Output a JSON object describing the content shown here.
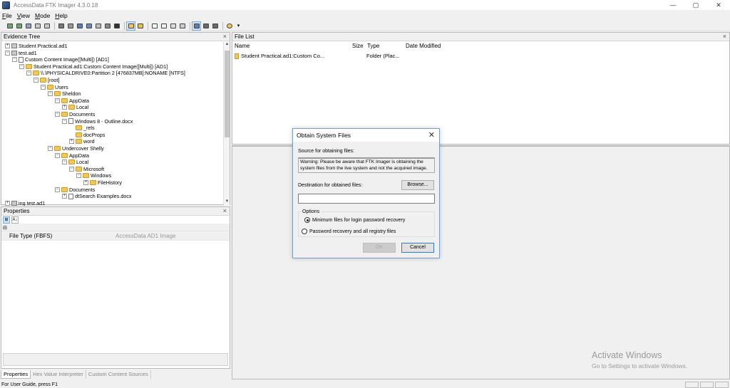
{
  "window": {
    "title": "AccessData FTK Imager 4.3.0.18",
    "minimize": "—",
    "maximize": "▢",
    "close": "✕"
  },
  "menu": [
    {
      "label": "File",
      "underline": "F",
      "rest": "ile"
    },
    {
      "label": "View",
      "underline": "V",
      "rest": "iew"
    },
    {
      "label": "Mode",
      "underline": "M",
      "rest": "ode"
    },
    {
      "label": "Help",
      "underline": "H",
      "rest": "elp"
    }
  ],
  "evidence_tree": {
    "title": "Evidence Tree",
    "close": "×",
    "items": [
      {
        "label": "Student Practical.ad1",
        "level": 0,
        "toggle": "+",
        "icon": "drive-icon"
      },
      {
        "label": "test.ad1",
        "level": 0,
        "toggle": "−",
        "icon": "drive-icon"
      },
      {
        "label": "Custom Content Image([Multi]) [AD1]",
        "level": 1,
        "toggle": "−",
        "icon": "image-icon"
      },
      {
        "label": "Student Practical.ad1:Custom Content Image([Multi]) [AD1]",
        "level": 2,
        "toggle": "−",
        "icon": "folder-icon"
      },
      {
        "label": "\\\\.\\PHYSICALDRIVE0:Partition 2 [476837MB]:NONAME [NTFS]",
        "level": 3,
        "toggle": "−",
        "icon": "folder-icon"
      },
      {
        "label": "[root]",
        "level": 4,
        "toggle": "−",
        "icon": "folder-icon"
      },
      {
        "label": "Users",
        "level": 5,
        "toggle": "−",
        "icon": "folder-icon"
      },
      {
        "label": "Sheldon",
        "level": 6,
        "toggle": "−",
        "icon": "folder-icon"
      },
      {
        "label": "AppData",
        "level": 7,
        "toggle": "−",
        "icon": "folder-icon"
      },
      {
        "label": "Local",
        "level": 8,
        "toggle": "+",
        "icon": "folder-icon"
      },
      {
        "label": "Documents",
        "level": 7,
        "toggle": "−",
        "icon": "folder-icon"
      },
      {
        "label": "Windows 8 - Outline.docx",
        "level": 8,
        "toggle": "−",
        "icon": "document-icon"
      },
      {
        "label": "_rels",
        "level": 9,
        "toggle": "",
        "icon": "folder-icon"
      },
      {
        "label": "docProps",
        "level": 9,
        "toggle": "",
        "icon": "folder-icon"
      },
      {
        "label": "word",
        "level": 9,
        "toggle": "+",
        "icon": "folder-icon"
      },
      {
        "label": "Undercover Shelly",
        "level": 6,
        "toggle": "−",
        "icon": "folder-icon"
      },
      {
        "label": "AppData",
        "level": 7,
        "toggle": "−",
        "icon": "folder-icon"
      },
      {
        "label": "Local",
        "level": 8,
        "toggle": "−",
        "icon": "folder-icon"
      },
      {
        "label": "Microsoft",
        "level": 9,
        "toggle": "−",
        "icon": "folder-icon"
      },
      {
        "label": "Windows",
        "level": 10,
        "toggle": "−",
        "icon": "folder-icon"
      },
      {
        "label": "FileHistory",
        "level": 11,
        "toggle": "+",
        "icon": "folder-icon"
      },
      {
        "label": "Documents",
        "level": 7,
        "toggle": "−",
        "icon": "folder-icon"
      },
      {
        "label": "dtSearch Examples.docx",
        "level": 8,
        "toggle": "+",
        "icon": "document-icon"
      },
      {
        "label": "ing test.ad1",
        "level": 0,
        "toggle": "+",
        "icon": "drive-icon"
      }
    ]
  },
  "properties": {
    "title": "Properties",
    "close": "×",
    "tool_categorized": "⊞",
    "tool_sort": "A↓",
    "category_toggle": "⊟",
    "rows": [
      {
        "key": "File Type (FBFS)",
        "value": "AccessData AD1 Image"
      }
    ]
  },
  "bottom_tabs": [
    "Properties",
    "Hex Value Interpreter",
    "Custom Content Sources"
  ],
  "file_list": {
    "title": "File List",
    "close": "×",
    "columns": {
      "name": "Name",
      "size": "Size",
      "type": "Type",
      "date": "Date Modified"
    },
    "rows": [
      {
        "name": "Student Practical.ad1:Custom Co...",
        "size": "",
        "type": "Folder (Plac...",
        "date": ""
      }
    ]
  },
  "dialog": {
    "title": "Obtain System Files",
    "close": "✕",
    "source_label": "Source for obtaining files:",
    "warning": "Warning:  Please be aware that FTK Imager is obtaining the system files from the live system and not the acquired image.",
    "destination_label": "Destination for obtained files:",
    "destination_value": "",
    "browse": "Browse...",
    "options_title": "Options",
    "option1": "Minimum files for login password recovery",
    "option2": "Password recovery and all registry files",
    "selected_option": 1,
    "ok": "OK",
    "cancel": "Cancel"
  },
  "status": {
    "text": "For User Guide, press F1"
  },
  "watermark": {
    "line1": "Activate Windows",
    "line2": "Go to Settings to activate Windows."
  }
}
